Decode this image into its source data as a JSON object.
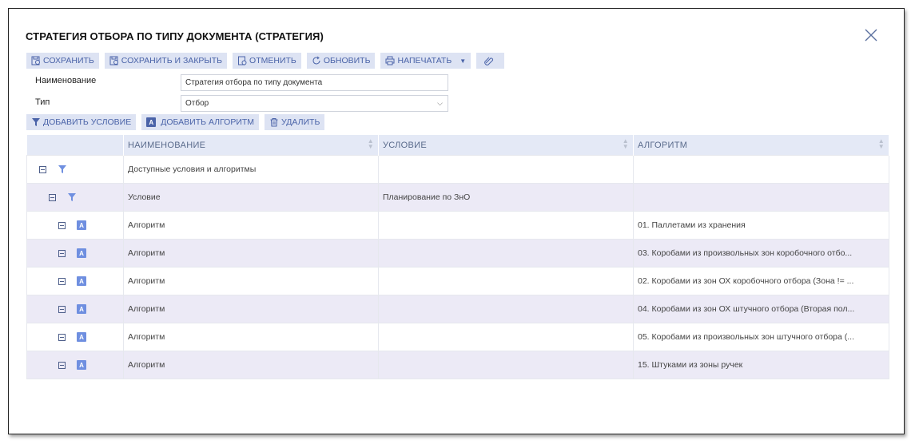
{
  "dialog": {
    "title": "СТРАТЕГИЯ ОТБОРА ПО ТИПУ ДОКУМЕНТА (СТРАТЕГИЯ)"
  },
  "toolbar": {
    "save": "СОХРАНИТЬ",
    "save_close": "СОХРАНИТЬ И ЗАКРЫТЬ",
    "cancel": "ОТМЕНИТЬ",
    "refresh": "ОБНОВИТЬ",
    "print": "НАПЕЧАТАТЬ"
  },
  "form": {
    "name_label": "Наименование",
    "name_value": "Стратегия отбора по типу документа",
    "type_label": "Тип",
    "type_value": "Отбор"
  },
  "tree_toolbar": {
    "add_condition": "ДОБАВИТЬ УСЛОВИЕ",
    "add_algorithm": "ДОБАВИТЬ АЛГОРИТМ",
    "delete": "УДАЛИТЬ"
  },
  "table": {
    "columns": [
      "НАИМЕНОВАНИЕ",
      "УСЛОВИЕ",
      "АЛГОРИТМ"
    ],
    "rows": [
      {
        "name": "Доступные условия и алгоритмы",
        "condition": "",
        "algorithm": ""
      },
      {
        "name": "Условие",
        "condition": "Планирование по ЗнО",
        "algorithm": ""
      },
      {
        "name": "Алгоритм",
        "condition": "",
        "algorithm": "01. Паллетами из хранения"
      },
      {
        "name": "Алгоритм",
        "condition": "",
        "algorithm": "03. Коробами из произвольных зон коробочного отбо..."
      },
      {
        "name": "Алгоритм",
        "condition": "",
        "algorithm": "02. Коробами из зон ОХ коробочного отбора (Зона != ..."
      },
      {
        "name": "Алгоритм",
        "condition": "",
        "algorithm": "04. Коробами из зон ОХ штучного отбора (Вторая пол..."
      },
      {
        "name": "Алгоритм",
        "condition": "",
        "algorithm": "05. Коробами из произвольных зон штучного отбора (..."
      },
      {
        "name": "Алгоритм",
        "condition": "",
        "algorithm": "15. Штуками из зоны ручек"
      }
    ]
  },
  "colors": {
    "button_bg": "#dde3f3",
    "button_text": "#4a63a8",
    "header_bg": "#e4e9f6",
    "alt_row": "#eceaf6",
    "icon_blue": "#6f8fe0"
  }
}
